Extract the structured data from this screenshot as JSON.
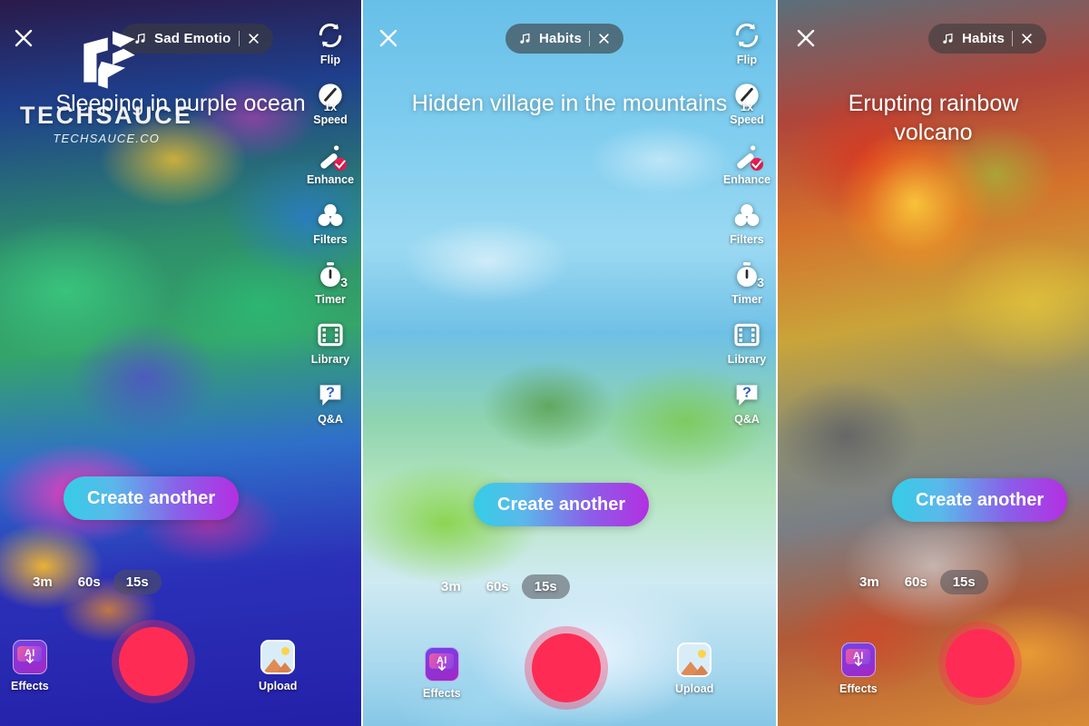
{
  "panels": [
    {
      "id": "panel-1",
      "prompt": "Sleeping in purple ocean",
      "music": {
        "title": "Sad Emotio",
        "note_icon": "music-note-icon",
        "close_icon": "close-icon"
      },
      "close_icon": "close-icon",
      "create_label": "Create another",
      "durations": [
        {
          "label": "3m",
          "active": false
        },
        {
          "label": "60s",
          "active": false
        },
        {
          "label": "15s",
          "active": true
        }
      ],
      "effects_label": "Effects",
      "effects_icon_text": "AI",
      "upload_label": "Upload",
      "tools": [
        {
          "label": "Flip",
          "icon": "flip-camera-icon"
        },
        {
          "label": "Speed",
          "icon": "speed-gauge-icon",
          "badge": "1x"
        },
        {
          "label": "Enhance",
          "icon": "enhance-wand-icon",
          "badge": "check"
        },
        {
          "label": "Filters",
          "icon": "filters-circles-icon"
        },
        {
          "label": "Timer",
          "icon": "timer-stopwatch-icon",
          "badge": "3"
        },
        {
          "label": "Library",
          "icon": "library-film-icon"
        },
        {
          "label": "Q&A",
          "icon": "qa-bubble-icon"
        }
      ]
    },
    {
      "id": "panel-2",
      "prompt": "Hidden village in the mountains",
      "music": {
        "title": "Habits",
        "note_icon": "music-note-icon",
        "close_icon": "close-icon"
      },
      "close_icon": "close-icon",
      "create_label": "Create another",
      "durations": [
        {
          "label": "3m",
          "active": false
        },
        {
          "label": "60s",
          "active": false
        },
        {
          "label": "15s",
          "active": true
        }
      ],
      "effects_label": "Effects",
      "effects_icon_text": "AI",
      "upload_label": "Upload",
      "tools": [
        {
          "label": "Flip",
          "icon": "flip-camera-icon"
        },
        {
          "label": "Speed",
          "icon": "speed-gauge-icon",
          "badge": "1x"
        },
        {
          "label": "Enhance",
          "icon": "enhance-wand-icon",
          "badge": "check"
        },
        {
          "label": "Filters",
          "icon": "filters-circles-icon"
        },
        {
          "label": "Timer",
          "icon": "timer-stopwatch-icon",
          "badge": "3"
        },
        {
          "label": "Library",
          "icon": "library-film-icon"
        },
        {
          "label": "Q&A",
          "icon": "qa-bubble-icon"
        }
      ]
    },
    {
      "id": "panel-3",
      "prompt": "Erupting rainbow volcano",
      "music": {
        "title": "Habits",
        "note_icon": "music-note-icon",
        "close_icon": "close-icon"
      },
      "close_icon": "close-icon",
      "create_label": "Create another",
      "durations": [
        {
          "label": "3m",
          "active": false
        },
        {
          "label": "60s",
          "active": false
        },
        {
          "label": "15s",
          "active": true
        }
      ],
      "effects_label": "Effects",
      "effects_icon_text": "AI",
      "upload_label": "Upload",
      "tools": []
    }
  ],
  "watermark": {
    "brand": "TECHSAUCE",
    "domain": "TECHSAUCE.CO",
    "logo_icon": "techsauce-logo-icon"
  },
  "colors": {
    "record_red": "#fe2c55",
    "accent_cyan": "#35cde6",
    "accent_purple": "#b42fe2",
    "badge_red": "#ee1d52"
  }
}
